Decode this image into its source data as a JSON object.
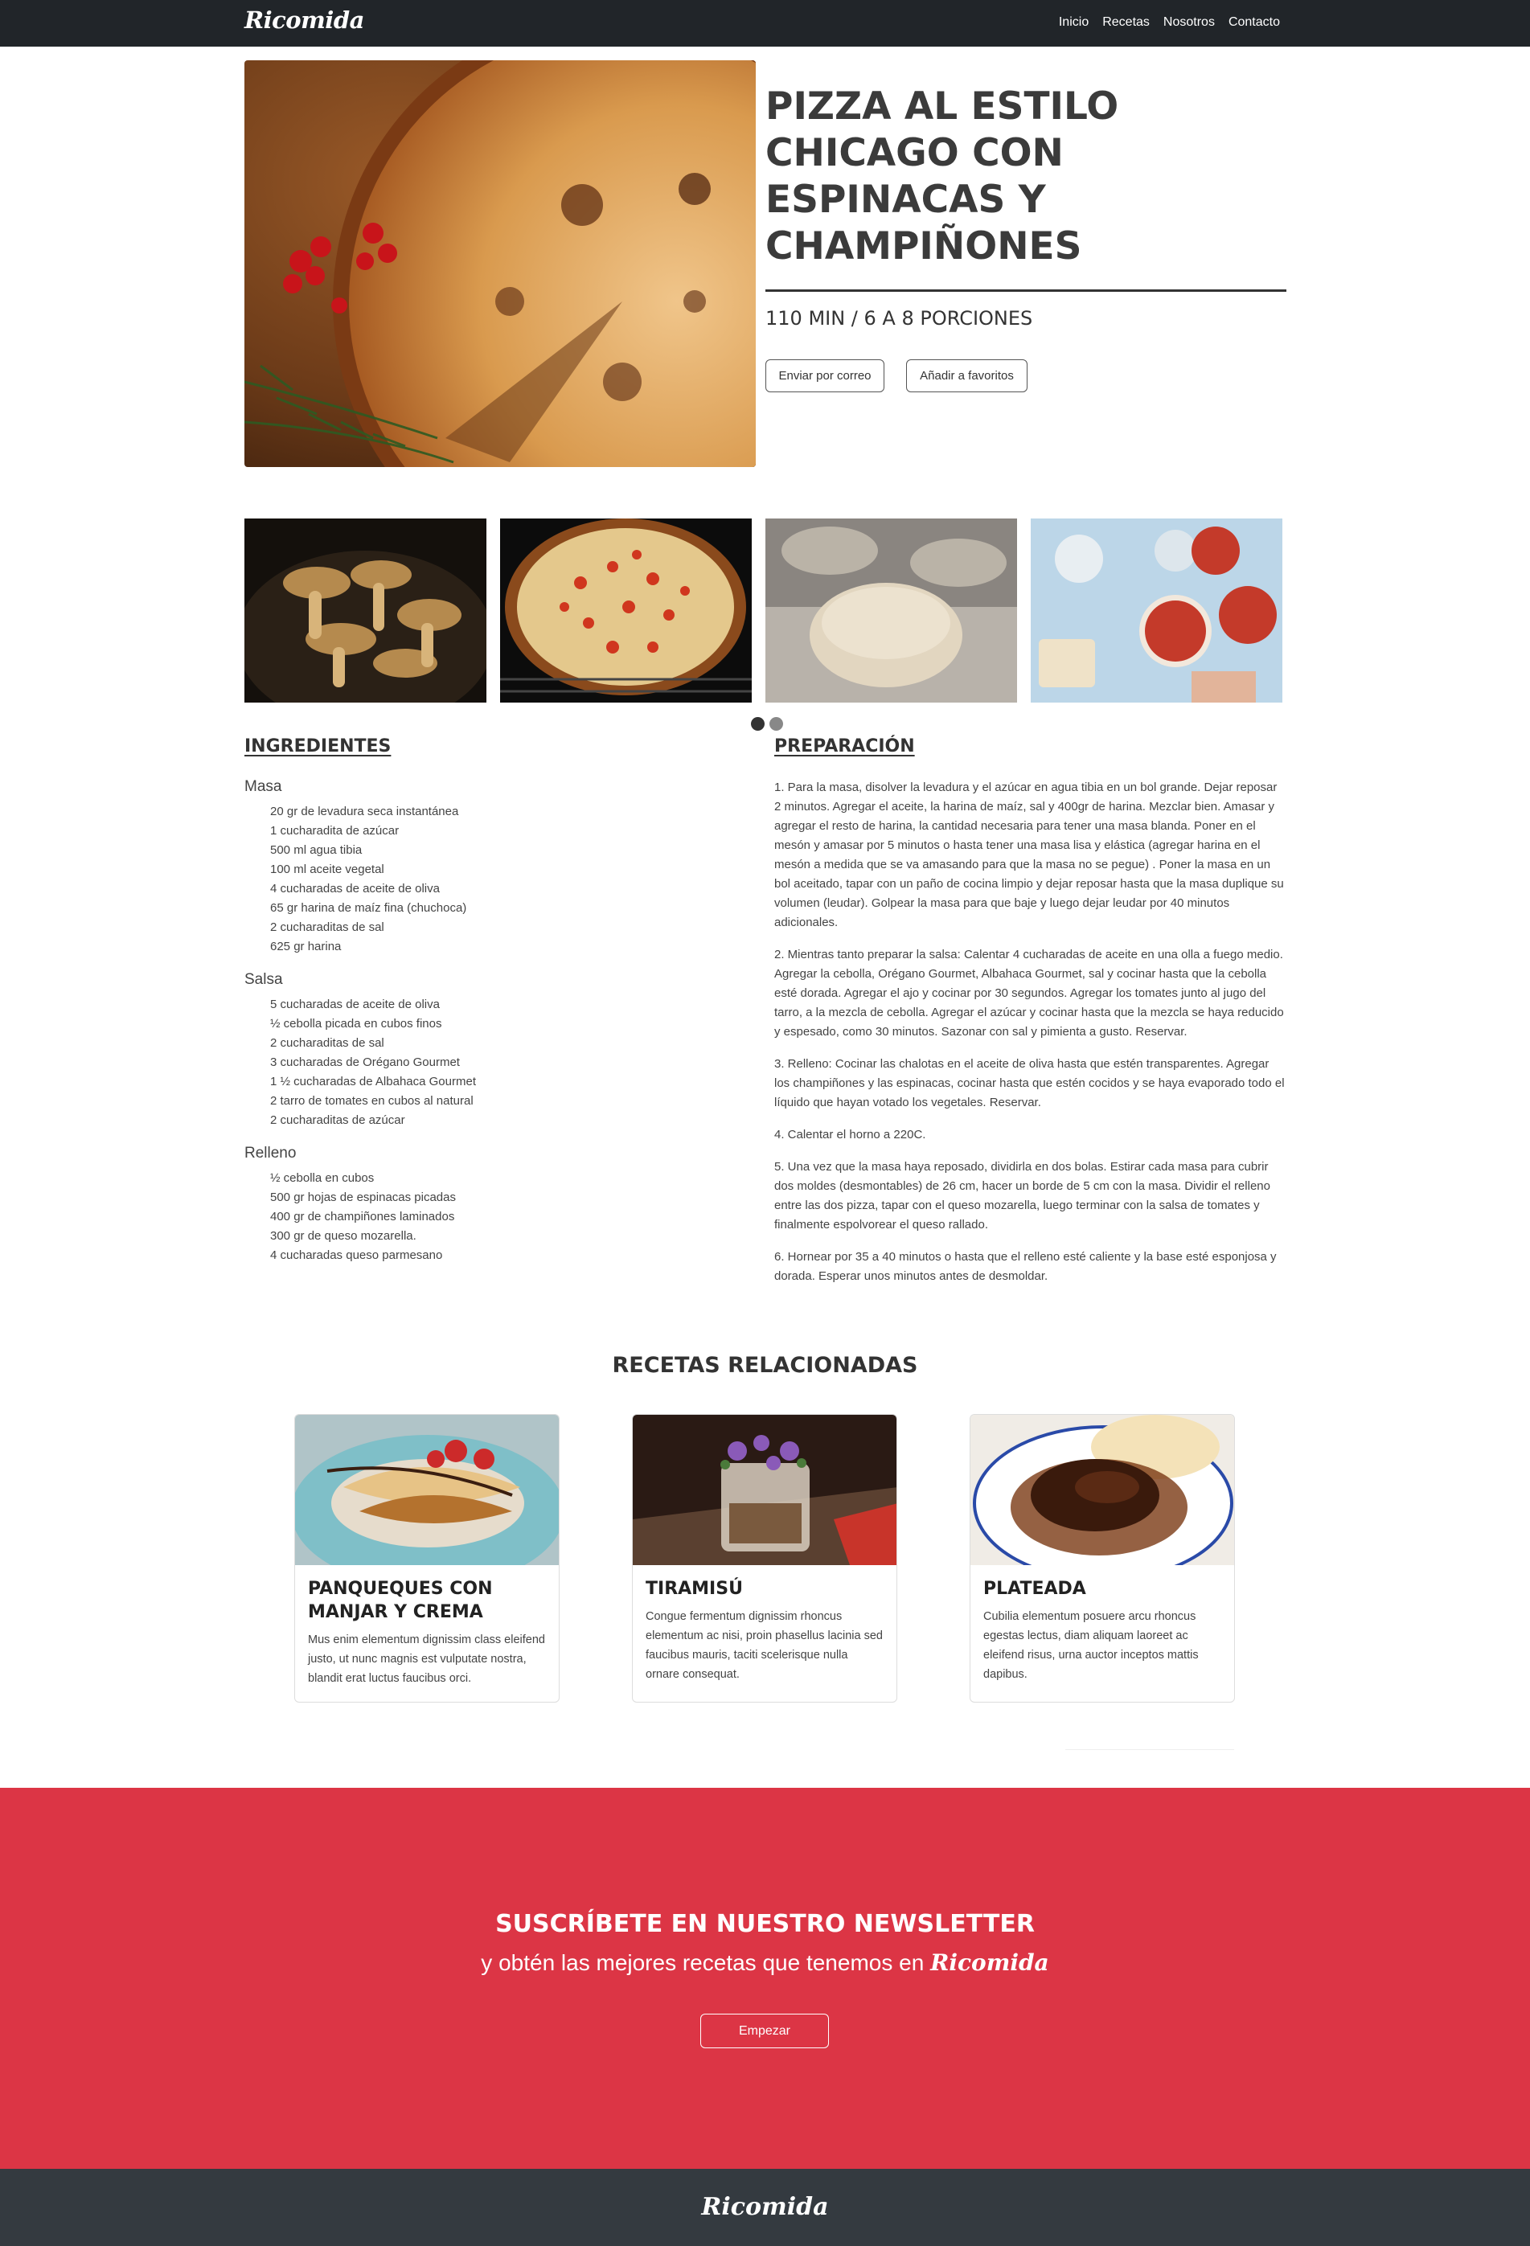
{
  "brand": "Ricomida",
  "nav": {
    "items": [
      "Inicio",
      "Recetas",
      "Nosotros",
      "Contacto"
    ]
  },
  "hero": {
    "title_lines": [
      "PIZZA AL ESTILO",
      "CHICAGO CON",
      "ESPINACAS Y",
      "CHAMPIÑONES"
    ],
    "meta": "110 MIN / 6 A 8 PORCIONES",
    "email_button": "Enviar por correo",
    "favorite_button": "Añadir a favoritos"
  },
  "carousel": {
    "thumbnails": [
      "mushrooms-photo",
      "pizza-oven-photo",
      "dough-photo",
      "pizza-making-photo"
    ],
    "active_slide": 1,
    "slide_count": 2
  },
  "ingredients": {
    "heading": "INGREDIENTES",
    "groups": [
      {
        "name": "Masa",
        "items": [
          "20 gr de levadura seca instantánea",
          "1 cucharadita de azúcar",
          "500 ml agua tibia",
          "100 ml aceite vegetal",
          "4 cucharadas de aceite de oliva",
          "65 gr harina de maíz fina (chuchoca)",
          "2 cucharaditas de sal",
          "625 gr harina"
        ]
      },
      {
        "name": "Salsa",
        "items": [
          "5 cucharadas de aceite de oliva",
          "½ cebolla picada en cubos finos",
          "2 cucharaditas de sal",
          "3 cucharadas de Orégano Gourmet",
          "1 ½ cucharadas de Albahaca Gourmet",
          "2 tarro de tomates en cubos al natural",
          "2 cucharaditas de azúcar"
        ]
      },
      {
        "name": "Relleno",
        "items": [
          "½ cebolla en cubos",
          "500 gr hojas de espinacas picadas",
          "400 gr de champiñones laminados",
          "300 gr de queso mozarella.",
          "4 cucharadas queso parmesano"
        ]
      }
    ]
  },
  "preparation": {
    "heading": "PREPARACIÓN",
    "steps": [
      "1. Para la masa, disolver la levadura y el azúcar en agua tibia en un bol grande. Dejar reposar 2 minutos. Agregar el aceite, la harina de maíz, sal y 400gr de harina. Mezclar bien. Amasar y agregar el resto de harina, la cantidad necesaria para tener una masa blanda. Poner en el mesón y amasar por 5 minutos o hasta tener una masa lisa y elástica (agregar harina en el mesón a medida que se va amasando para que la masa no se pegue) . Poner la masa en un bol aceitado, tapar con un paño de cocina limpio y dejar reposar hasta que la masa duplique su volumen (leudar). Golpear la masa para que baje y luego dejar leudar por 40 minutos adicionales.",
      "2. Mientras tanto preparar la salsa: Calentar 4 cucharadas de aceite en una olla a fuego medio. Agregar la cebolla, Orégano Gourmet, Albahaca Gourmet, sal y cocinar hasta que la cebolla esté dorada. Agregar el ajo y cocinar por 30 segundos. Agregar los tomates junto al jugo del tarro, a la mezcla de cebolla. Agregar el azúcar y cocinar hasta que la mezcla se haya reducido y espesado, como 30 minutos. Sazonar con sal y pimienta a gusto. Reservar.",
      "3. Relleno: Cocinar las chalotas en el aceite de oliva hasta que estén transparentes. Agregar los champiñones y las espinacas, cocinar hasta que estén cocidos y se haya evaporado todo el líquido que hayan votado los vegetales. Reservar.",
      "4. Calentar el horno a 220C.",
      "5. Una vez que la masa haya reposado, dividirla en dos bolas. Estirar cada masa para cubrir dos moldes (desmontables) de 26 cm, hacer un borde de 5 cm con la masa. Dividir el relleno entre las dos pizza, tapar con el queso mozarella, luego terminar con la salsa de tomates y finalmente espolvorear el queso rallado.",
      "6. Hornear por 35 a 40 minutos o hasta que el relleno esté caliente y la base esté esponjosa y dorada. Esperar unos minutos antes de desmoldar."
    ]
  },
  "related": {
    "heading": "RECETAS RELACIONADAS",
    "cards": [
      {
        "title": "PANQUEQUES CON MANJAR Y CREMA",
        "text": "Mus enim elementum dignissim class eleifend justo, ut nunc magnis est vulputate nostra, blandit erat luctus faucibus orci."
      },
      {
        "title": "TIRAMISÚ",
        "text": "Congue fermentum dignissim rhoncus elementum ac nisi, proin phasellus lacinia sed faucibus mauris, taciti scelerisque nulla ornare consequat."
      },
      {
        "title": "PLATEADA",
        "text": "Cubilia elementum posuere arcu rhoncus egestas lectus, diam aliquam laoreet ac eleifend risus, urna auctor inceptos mattis dapibus."
      }
    ]
  },
  "newsletter": {
    "title": "SUSCRÍBETE EN NUESTRO NEWSLETTER",
    "subtitle": "y obtén las mejores recetas que tenemos en",
    "brand": "Ricomida",
    "button": "Empezar"
  },
  "footer": {
    "brand": "Ricomida"
  },
  "colors": {
    "navbar": "#212529",
    "newsletter": "#dc3545",
    "footer": "#343a40"
  }
}
